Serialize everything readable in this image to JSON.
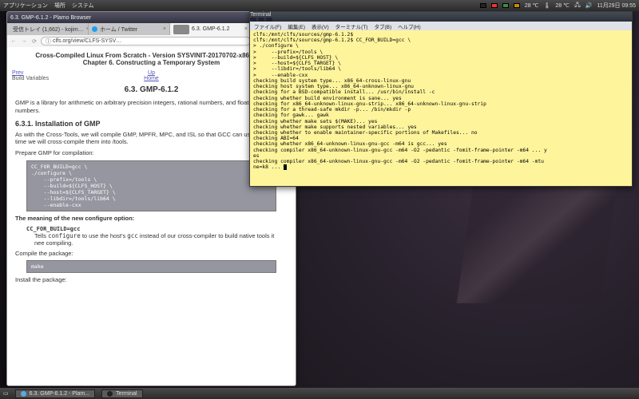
{
  "top_panel": {
    "menus": [
      "アプリケーション",
      "場所",
      "システム"
    ],
    "tray": {
      "temp1": "28 ℃",
      "temp2": "28 ℃",
      "date": "11月29日 09:55"
    }
  },
  "bottom_panel": {
    "tasks": [
      {
        "label": "6.3. GMP-6.1.2 - Plam..."
      },
      {
        "label": "Terminal"
      }
    ]
  },
  "browser": {
    "window_title": "6.3. GMP-6.1.2 - Plamo Browser",
    "tabs": [
      {
        "label": "受信トレイ (1,662) - kojim…",
        "active": false
      },
      {
        "label": "ホーム / Twitter",
        "active": false
      },
      {
        "label": "6.3. GMP-6.1.2",
        "active": true
      }
    ],
    "url": "clfs.org/view/CLFS-SYSV…",
    "zoom": "120%",
    "doc": {
      "series_line1": "Cross-Compiled Linux From Scratch - Version SYSVINIT-20170702-x86_64-M",
      "series_line2": "Chapter 6. Constructing a Temporary System",
      "nav_prev": "Prev",
      "nav_prev_lbl": "Build Variables",
      "nav_up": "Up",
      "nav_home": "Home",
      "nav_right": "MP",
      "title": "6.3. GMP-6.1.2",
      "intro": "GMP is a library for arithmetic on arbitrary precision integers, rational numbers, and floating-po numbers.",
      "sub_title": "6.3.1. Installation of GMP",
      "p1": "As with the Cross-Tools, we will compile GMP, MPFR, MPC, and ISL so that GCC can use them, t this time we will cross-compile them into /tools.",
      "p2": "Prepare GMP for compilation:",
      "code1": "CC_FOR_BUILD=gcc \\\n./configure \\\n    --prefix=/tools \\\n    --build=${CLFS_HOST} \\\n    --host=${CLFS_TARGET} \\\n    --libdir=/tools/lib64 \\\n    --enable-cxx",
      "opt_intro": "The meaning of the new configure option:",
      "opt_term": "CC_FOR_BUILD=gcc",
      "opt_desc_a": "Tells ",
      "opt_desc_b": "configure",
      "opt_desc_c": " to use the host's ",
      "opt_desc_d": "gcc",
      "opt_desc_e": " instead of our cross-compiler to build native tools it nee compiling.",
      "p3": "Compile the package:",
      "code2": "make",
      "p4": "Install the package:"
    }
  },
  "terminal": {
    "window_title": "Terminal",
    "menus": [
      "ファイル(F)",
      "編集(E)",
      "表示(V)",
      "ターミナル(T)",
      "タブ(B)",
      "ヘルプ(H)"
    ],
    "output": "clfs:/mnt/clfs/sources/gmp-6.1.2$\nclfs:/mnt/clfs/sources/gmp-6.1.2$ CC_FOR_BUILD=gcc \\\n> ./configure \\\n>     --prefix=/tools \\\n>     --build=${CLFS_HOST} \\\n>     --host=${CLFS_TARGET} \\\n>     --libdir=/tools/lib64 \\\n>     --enable-cxx\nchecking build system type... x86_64-cross-linux-gnu\nchecking host system type... x86_64-unknown-linux-gnu\nchecking for a BSD-compatible install... /usr/bin/install -c\nchecking whether build environment is sane... yes\nchecking for x86_64-unknown-linux-gnu-strip... x86_64-unknown-linux-gnu-strip\nchecking for a thread-safe mkdir -p... /bin/mkdir -p\nchecking for gawk... gawk\nchecking whether make sets $(MAKE)... yes\nchecking whether make supports nested variables... yes\nchecking whether to enable maintainer-specific portions of Makefiles... no\nchecking ABI=64\nchecking whether x86_64-unknown-linux-gnu-gcc -m64 is gcc... yes\nchecking compiler x86_64-unknown-linux-gnu-gcc -m64 -O2 -pedantic -fomit-frame-pointer -m64 ... y\nes\nchecking compiler x86_64-unknown-linux-gnu-gcc -m64 -O2 -pedantic -fomit-frame-pointer -m64 -mtu\nne=k8 ... "
  }
}
